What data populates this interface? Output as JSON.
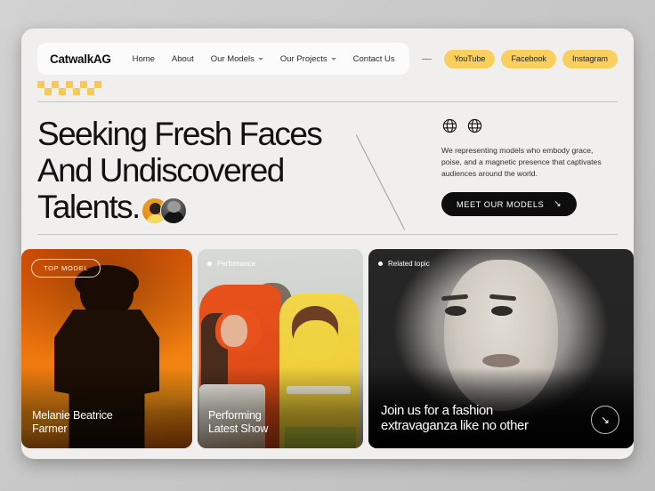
{
  "nav": {
    "brand": "CatwalkAG",
    "links": [
      {
        "label": "Home",
        "caret": false
      },
      {
        "label": "About",
        "caret": false
      },
      {
        "label": "Our Models",
        "caret": true
      },
      {
        "label": "Our Projects",
        "caret": true
      },
      {
        "label": "Contact Us",
        "caret": false
      }
    ],
    "socials": [
      "YouTube",
      "Facebook",
      "Instagram"
    ]
  },
  "hero": {
    "headline_line1": "Seeking Fresh Faces",
    "headline_line2": "And Undiscovered",
    "headline_line3": "Talents.",
    "paragraph": "We representing models who embody grace, poise, and a magnetic presence that captivates audiences around the world.",
    "cta_label": "MEET OUR MODELS",
    "cta_arrow": "↘"
  },
  "cards": [
    {
      "badge": "TOP MODEL",
      "badge_style": "outline",
      "title_line1": "Melanie Beatrice",
      "title_line2": "Farmer"
    },
    {
      "badge": "Perfomance",
      "badge_style": "dot",
      "title_line1": "Performing",
      "title_line2": "Latest Show"
    },
    {
      "badge": "Related topic",
      "badge_style": "dot",
      "title_line1": "Join us for a fashion",
      "title_line2": "extravaganza like no other",
      "arrow": "↘"
    }
  ],
  "colors": {
    "accent_yellow": "#f9cf5d",
    "canvas": "#f0efed",
    "page_bg": "#c9c9c9",
    "dark": "#0d0d0d"
  }
}
